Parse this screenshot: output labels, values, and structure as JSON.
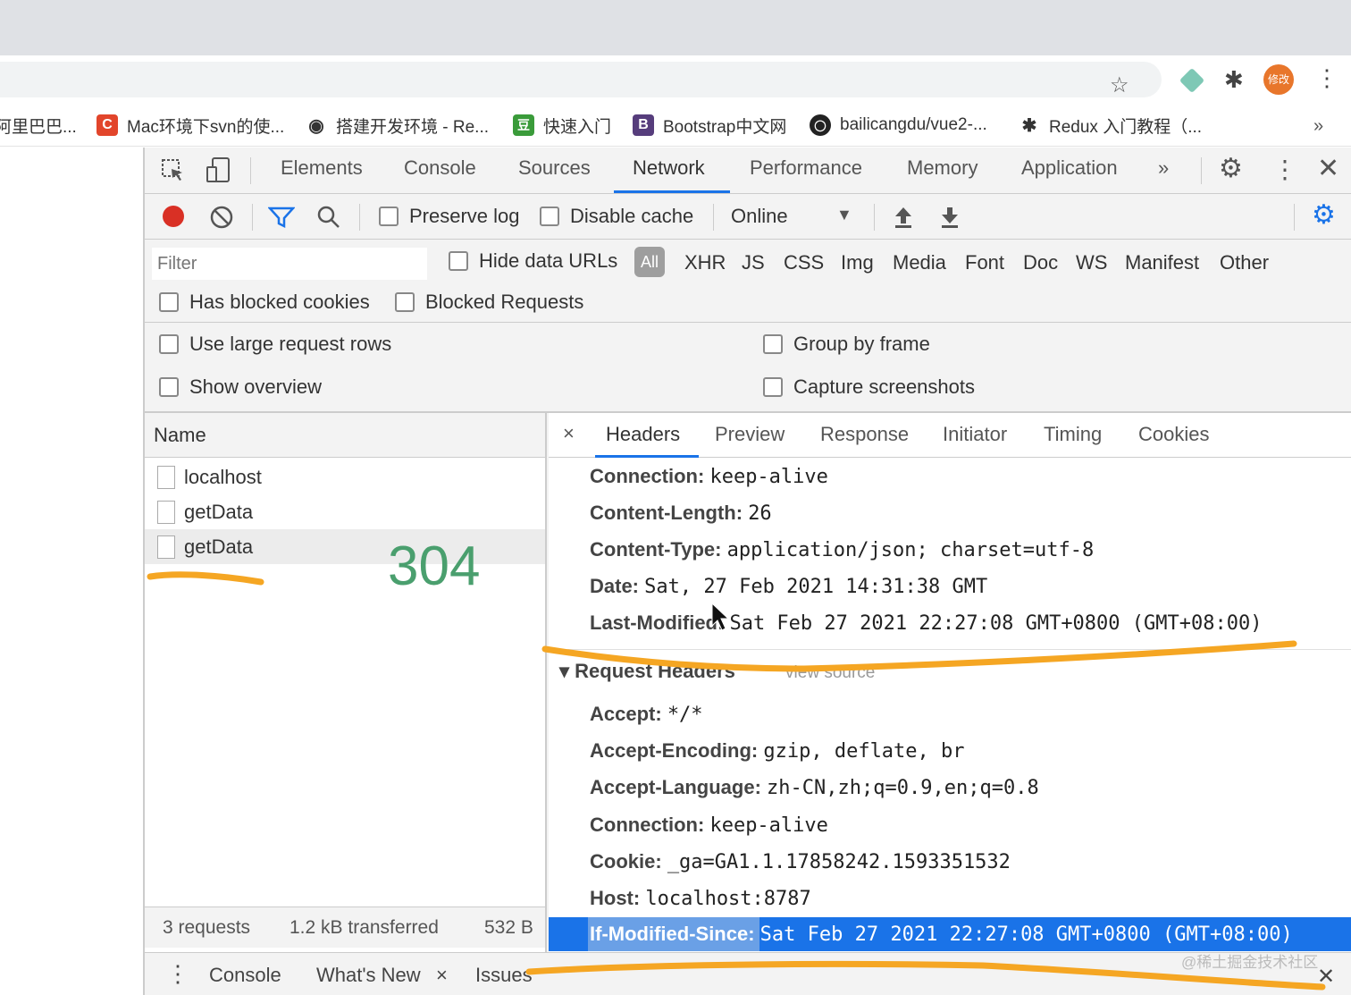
{
  "bookmarks": [
    {
      "icon": "",
      "label": "阿里巴巴..."
    },
    {
      "icon": "C",
      "label": "Mac环境下svn的使..."
    },
    {
      "icon": "◉",
      "label": "搭建开发环境 - Re..."
    },
    {
      "icon": "豆",
      "label": "快速入门"
    },
    {
      "icon": "B",
      "label": "Bootstrap中文网"
    },
    {
      "icon": "◯",
      "label": "bailicangdu/vue2-..."
    },
    {
      "icon": "✱",
      "label": "Redux 入门教程（..."
    }
  ],
  "bookmarks_more": "»",
  "profile_initials": "修改",
  "devtools": {
    "tabs": [
      "Elements",
      "Console",
      "Sources",
      "Network",
      "Performance",
      "Memory",
      "Application"
    ],
    "active_tab": "Network",
    "tabs_overflow": "»",
    "toolbar": {
      "preserve_log": "Preserve log",
      "disable_cache": "Disable cache",
      "throttle": "Online"
    },
    "filter": {
      "placeholder": "Filter",
      "hide_data_urls": "Hide data URLs",
      "types": [
        "All",
        "XHR",
        "JS",
        "CSS",
        "Img",
        "Media",
        "Font",
        "Doc",
        "WS",
        "Manifest",
        "Other"
      ],
      "has_blocked_cookies": "Has blocked cookies",
      "blocked_requests": "Blocked Requests"
    },
    "settings": {
      "large_rows": "Use large request rows",
      "show_overview": "Show overview",
      "group_by_frame": "Group by frame",
      "capture_screenshots": "Capture screenshots"
    },
    "name_column": "Name",
    "requests": [
      "localhost",
      "getData",
      "getData"
    ],
    "annotation_status": "304",
    "summary": {
      "requests": "3 requests",
      "transferred": "1.2 kB transferred",
      "resources": "532 B"
    },
    "detail_tabs": [
      "Headers",
      "Preview",
      "Response",
      "Initiator",
      "Timing",
      "Cookies"
    ],
    "close_detail": "×",
    "response_headers": [
      {
        "key": "Connection:",
        "value": "keep-alive"
      },
      {
        "key": "Content-Length:",
        "value": "26"
      },
      {
        "key": "Content-Type:",
        "value": "application/json; charset=utf-8"
      },
      {
        "key": "Date:",
        "value": "Sat, 27 Feb 2021 14:31:38 GMT"
      },
      {
        "key": "Last-Modified:",
        "value": "Sat Feb 27 2021 22:27:08 GMT+0800 (GMT+08:00)"
      }
    ],
    "request_headers_title": "▾ Request Headers",
    "view_source": "view source",
    "request_headers": [
      {
        "key": "Accept:",
        "value": "*/*"
      },
      {
        "key": "Accept-Encoding:",
        "value": "gzip, deflate, br"
      },
      {
        "key": "Accept-Language:",
        "value": "zh-CN,zh;q=0.9,en;q=0.8"
      },
      {
        "key": "Connection:",
        "value": "keep-alive"
      },
      {
        "key": "Cookie:",
        "value": "_ga=GA1.1.17858242.1593351532"
      },
      {
        "key": "Host:",
        "value": "localhost:8787"
      },
      {
        "key": "If-Modified-Since:",
        "value": "Sat Feb 27 2021 22:27:08 GMT+0800 (GMT+08:00)"
      }
    ],
    "drawer": {
      "console": "Console",
      "whats_new": "What's New",
      "whats_new_close": "×",
      "issues": "Issues",
      "close": "✕"
    }
  },
  "watermark": "@稀土掘金技术社区",
  "colors": {
    "accent": "#1a73e8",
    "record": "#d93025",
    "annotation": "#f5a623",
    "status_304": "#4a9f6e"
  }
}
